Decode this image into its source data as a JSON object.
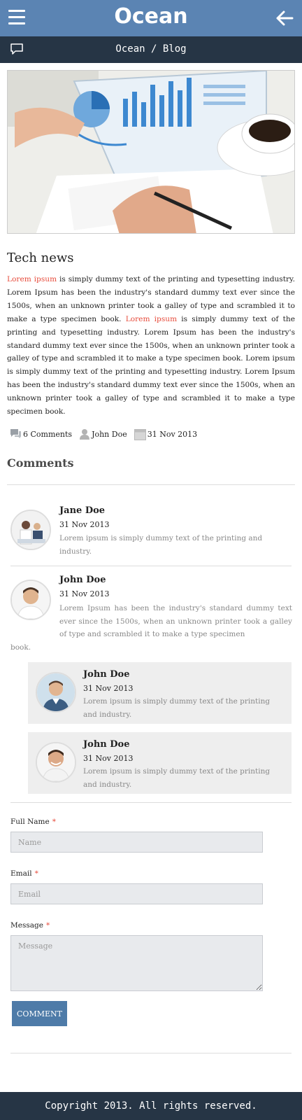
{
  "header": {
    "logo_text": "Ocean",
    "menu_icon": "hamburger-menu-icon",
    "back_icon": "arrow-left-icon",
    "bg_color": "#5b84b3"
  },
  "breadcrumb": {
    "icon": "chat-bubble-icon",
    "text": "Ocean / Blog"
  },
  "post": {
    "title": "Tech news",
    "body": [
      {
        "text": "Lorem ipsum",
        "highlight": true
      },
      {
        "text": " is simply dummy text of the printing and typesetting industry. Lorem Ipsum has been the industry's standard dummy text ever since the 1500s, when an unknown printer took a galley of type and scrambled it to make a type specimen book. ",
        "highlight": false
      },
      {
        "text": "Lorem ipsum",
        "highlight": true
      },
      {
        "text": " is simply dummy text of the printing and typesetting industry. Lorem Ipsum has been the industry's standard dummy text ever since the 1500s, when an unknown printer took a galley of type and scrambled it to make a type specimen book. Lorem ipsum is simply dummy text of the printing and typesetting industry. Lorem Ipsum has been the industry's standard dummy text ever since the 1500s, when an unknown printer took a galley of type and scrambled it to make a type specimen book.",
        "highlight": false
      }
    ],
    "meta": {
      "comments": "6 Comments",
      "author": "John Doe",
      "date": "31 Nov 2013"
    }
  },
  "comments_section": {
    "heading": "Comments",
    "comments": [
      {
        "name": "Jane Doe",
        "date": "31 Nov 2013",
        "text": "Lorem ipsum is simply dummy text of the printing and industry."
      },
      {
        "name": "John Doe",
        "date": "31 Nov 2013",
        "text_first": "Lorem Ipsum has been the industry's standard dummy text ever since the 1500s, when an unknown printer took a galley of type and scrambled it to make a type specimen",
        "text_last": "book."
      },
      {
        "name": "John Doe",
        "date": "31 Nov 2013",
        "text": "Lorem ipsum is simply dummy text of the printing and industry."
      },
      {
        "name": "John Doe",
        "date": "31 Nov 2013",
        "text": "Lorem ipsum is simply dummy text of the printing and industry."
      }
    ]
  },
  "form": {
    "name_label": "Full Name",
    "name_placeholder": "Name",
    "email_label": "Email",
    "email_placeholder": "Email",
    "message_label": "Message",
    "message_placeholder": "Message",
    "required_mark": "*",
    "submit_label": "COMMENT"
  },
  "footer": {
    "text": "Copyright 2013. All rights reserved."
  },
  "colors": {
    "accent": "#5b84b3",
    "dark": "#263545",
    "highlight_red": "#e74c3c",
    "button": "#4e7ba8"
  }
}
